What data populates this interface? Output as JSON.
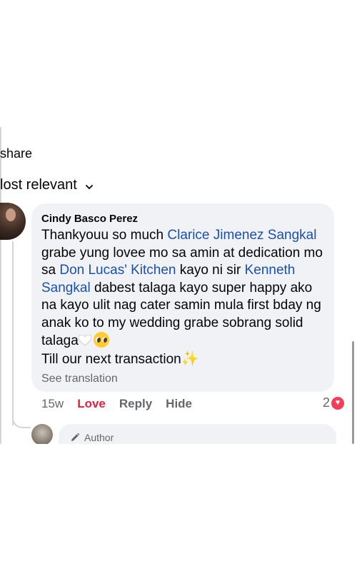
{
  "header": {
    "share_label": "share",
    "sort_label": "lost relevant"
  },
  "comment": {
    "author": "Cindy Basco Perez",
    "text_parts": [
      "Thankyouu so much ",
      "Clarice Jimenez Sangkal",
      " grabe yung lovee mo sa amin at dedication mo sa ",
      "Don Lucas' Kitchen",
      " kayo ni sir ",
      "Kenneth Sangkal",
      " dabest talaga kayo super happy ako na kayo ulit nag cater samin mula first bday ng anak ko to my wedding grabe sobrang solid talaga",
      "Till our next transaction",
      "✨"
    ],
    "see_translation": "See translation",
    "time": "15w",
    "love": "Love",
    "reply": "Reply",
    "hide": "Hide",
    "reaction_count": "2"
  },
  "reply_preview": {
    "badge": "Author"
  },
  "icons": {
    "sort": "chevron-down-icon",
    "reaction": "heart-reaction-icon",
    "badge": "pencil-icon",
    "emoji_1": "white-heart-emoji",
    "emoji_2": "pleading-face-emoji"
  },
  "colors": {
    "mention": "#1b4fb0",
    "love": "#e41e3f",
    "bubble": "#f0f2f5",
    "muted": "#65676b"
  }
}
